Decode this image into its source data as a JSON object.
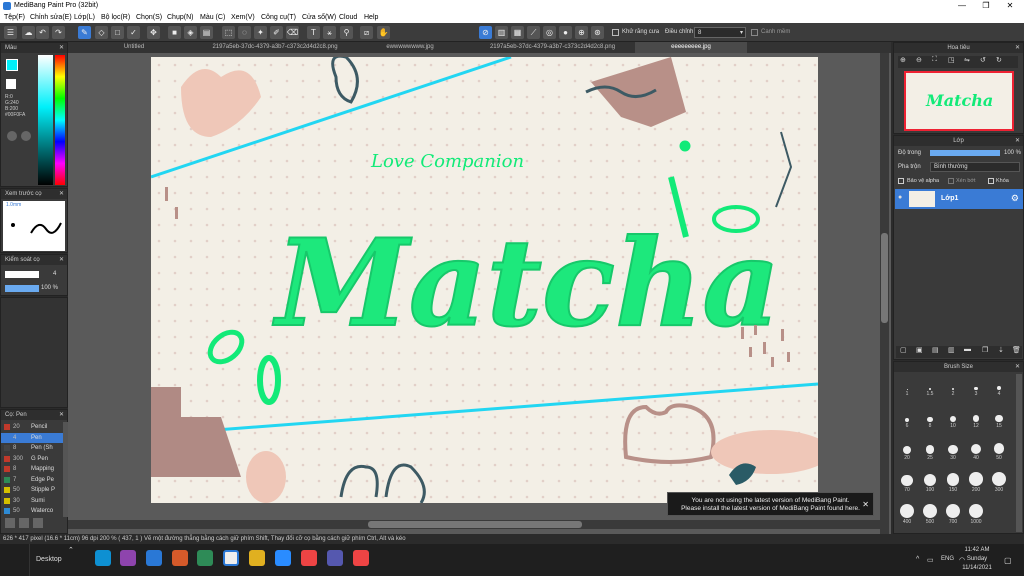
{
  "window": {
    "title": "MediBang Paint Pro (32bit)"
  },
  "menu": [
    "Tệp(F)",
    "Chỉnh sửa(E)",
    "Lớp(L)",
    "Bộ lọc(R)",
    "Chọn(S)",
    "Chụp(N)",
    "Màu (C)",
    "Xem(V)",
    "Công cụ(T)",
    "Cửa sổ(W)",
    "Cloud",
    "Help"
  ],
  "toolbar": {
    "antialias_label": "Khử răng cưa",
    "adjust_label": "Điều chỉnh",
    "adjust_value": "8",
    "snap_label": "Canh mềm"
  },
  "tabs": [
    "Untitled",
    "2197a5eb-37dc-4379-a3b7-c373c2d4d2c8.png",
    "ewwwwwwww.jpg",
    "2197a5eb-37dc-4379-a3b7-c373c2d4d2c8.png",
    "eeeeeeeee.jpg"
  ],
  "left": {
    "color_panel_title": "Màu",
    "rgb": {
      "r": "R:0",
      "g": "G:240",
      "b": "B:200",
      "hex": "#00F0FA"
    },
    "preview_title": "Xem trước cọ",
    "brush_size_label": "1.0mm",
    "brush_control_title": "Kiểm soát cọ",
    "brush_control": {
      "size": "4",
      "opacity": "100 %"
    },
    "brush_list_title": "Cọ: Pen",
    "brushes": [
      {
        "n": "20",
        "name": "Pencil",
        "color": "#c0392b"
      },
      {
        "n": "4",
        "name": "Pen",
        "color": "#3a7bd5",
        "sel": true
      },
      {
        "n": "8",
        "name": "Pen (Sh",
        "color": "#444444"
      },
      {
        "n": "300",
        "name": "G Pen",
        "color": "#c0392b"
      },
      {
        "n": "8",
        "name": "Mapping",
        "color": "#c0392b"
      },
      {
        "n": "7",
        "name": "Edge Pe",
        "color": "#2e8b57"
      },
      {
        "n": "50",
        "name": "Stipple P",
        "color": "#d4c000"
      },
      {
        "n": "30",
        "name": "Sumi",
        "color": "#d4c000"
      },
      {
        "n": "50",
        "name": "Waterco",
        "color": "#2e8bd5"
      }
    ]
  },
  "right": {
    "navigator_title": "Hoa tiêu",
    "layer_title": "Lớp",
    "opacity_label": "Độ trong",
    "opacity_value": "100 %",
    "blend_label": "Pha trộn",
    "blend_value": "Bình thường",
    "protect_alpha": "Bảo vệ alpha",
    "clipping": "Xén bớt",
    "lock": "Khóa",
    "layer_name": "Lớp1",
    "brush_size_title": "Brush Size",
    "sizes": [
      "1",
      "1.5",
      "2",
      "3",
      "4",
      "6",
      "8",
      "10",
      "12",
      "15",
      "20",
      "25",
      "30",
      "40",
      "50",
      "70",
      "100",
      "150",
      "200",
      "300",
      "400",
      "500",
      "700",
      "1000"
    ]
  },
  "canvas": {
    "small_text": "Love Companion",
    "title_text": "Matcha"
  },
  "notice": {
    "line1": "You are not using the latest version of MediBang Paint.",
    "line2": "Please install the latest version of MediBang Paint found here."
  },
  "status": {
    "text": "626 * 417 pixel   (16.6 * 11cm)   96 dpi   200 %  ( 437, 1 )  Vẽ một đường thẳng bằng cách giữ phím Shift, Thay đổi cỡ cọ bằng cách giữ phím Ctrl, Alt và kéo"
  },
  "taskbar": {
    "desktop_label": "Desktop",
    "lang": "ENG",
    "time": "11:42 AM",
    "day": "Sunday",
    "date": "11/14/2021"
  }
}
